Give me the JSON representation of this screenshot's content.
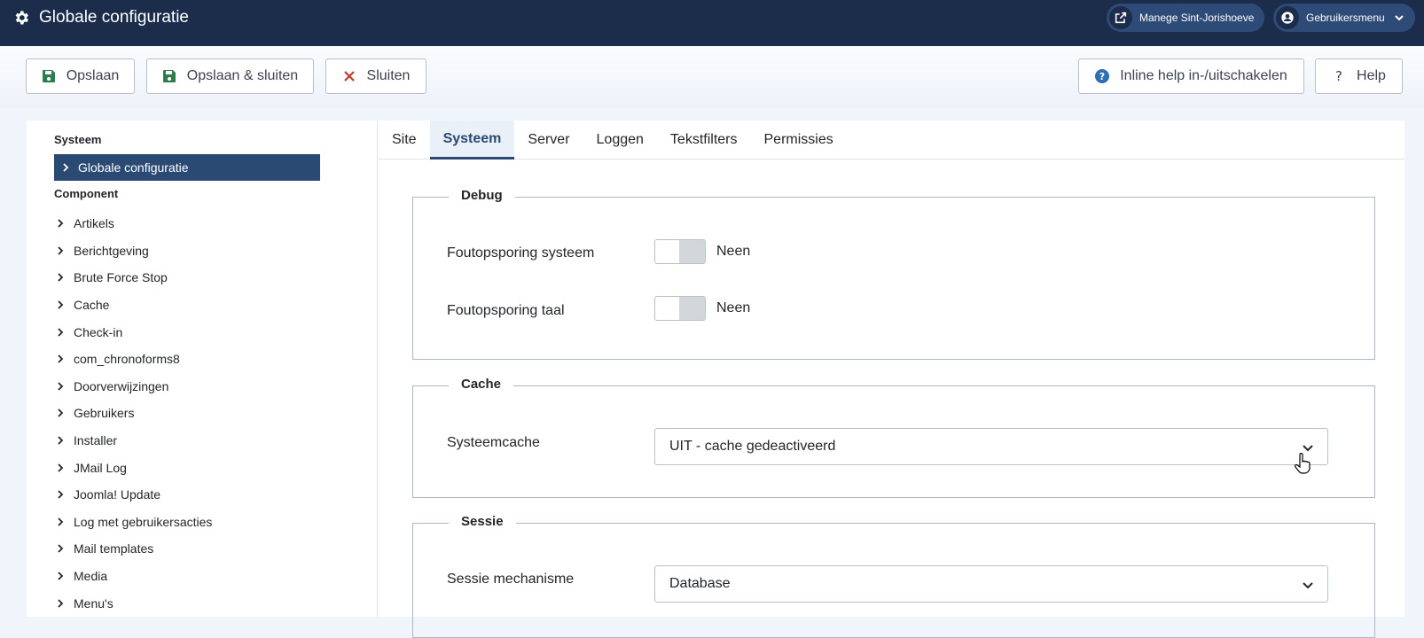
{
  "header": {
    "title": "Globale configuratie",
    "site_link": "Manege Sint-Jorishoeve",
    "user_menu": "Gebruikersmenu"
  },
  "toolbar": {
    "save": "Opslaan",
    "save_close": "Opslaan & sluiten",
    "close": "Sluiten",
    "inline_help": "Inline help in-/uitschakelen",
    "help": "Help"
  },
  "sidebar": {
    "system_heading": "Systeem",
    "selected": "Globale configuratie",
    "component_heading": "Component",
    "items": [
      "Artikels",
      "Berichtgeving",
      "Brute Force Stop",
      "Cache",
      "Check-in",
      "com_chronoforms8",
      "Doorverwijzingen",
      "Gebruikers",
      "Installer",
      "JMail Log",
      "Joomla! Update",
      "Log met gebruikersacties",
      "Mail templates",
      "Media",
      "Menu's"
    ]
  },
  "tabs": [
    "Site",
    "Systeem",
    "Server",
    "Loggen",
    "Tekstfilters",
    "Permissies"
  ],
  "active_tab": "Systeem",
  "debug": {
    "legend": "Debug",
    "system_debug_label": "Foutopsporing systeem",
    "system_debug_value": "Neen",
    "language_debug_label": "Foutopsporing taal",
    "language_debug_value": "Neen"
  },
  "cache": {
    "legend": "Cache",
    "system_cache_label": "Systeemcache",
    "system_cache_value": "UIT - cache gedeactiveerd"
  },
  "session": {
    "legend": "Sessie",
    "handler_label": "Sessie mechanisme",
    "handler_value": "Database"
  },
  "colors": {
    "header": "#1c2d4b",
    "accent": "#2b4a73",
    "save_icon": "#2e7d4f",
    "close_icon": "#c0392b",
    "help_icon": "#2f6db5"
  }
}
